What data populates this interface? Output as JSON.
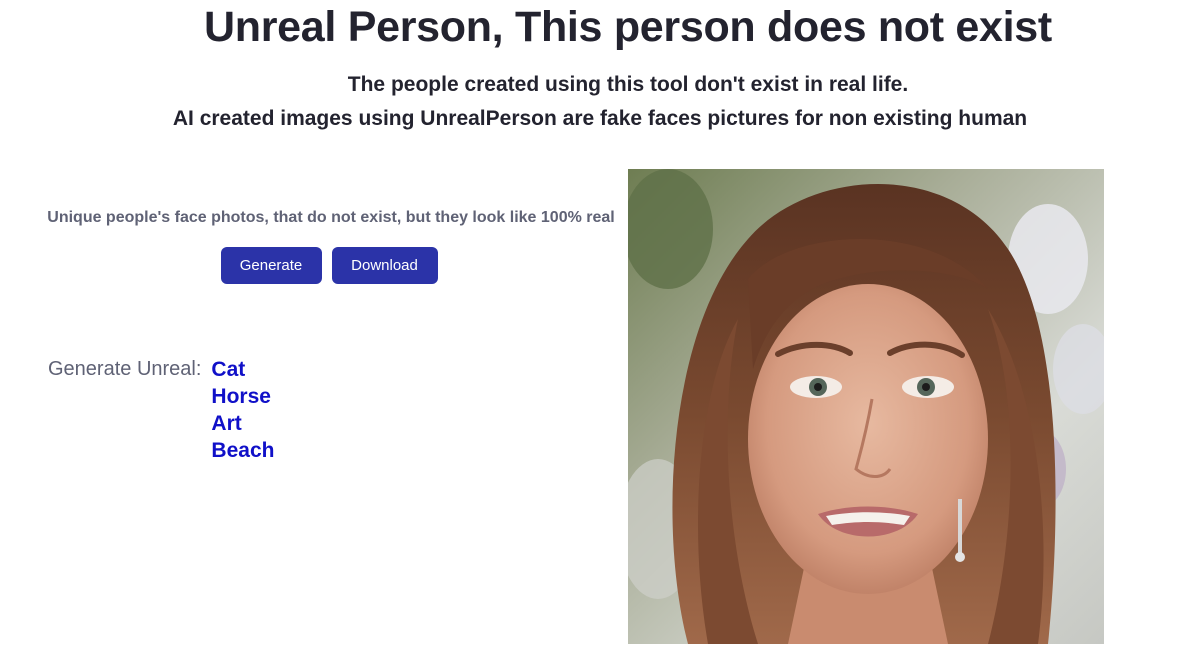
{
  "header": {
    "title": "Unreal Person, This person does not exist",
    "subtitle_line1": "The people created using this tool don't exist in real life.",
    "subtitle_line2": "AI created images using UnrealPerson are fake faces pictures for non existing human"
  },
  "main": {
    "tagline": "Unique people's face photos, that do not exist, but they look like 100% real",
    "buttons": {
      "generate_label": "Generate",
      "download_label": "Download"
    },
    "generate_unreal": {
      "label": "Generate Unreal:",
      "links": [
        "Cat",
        "Horse",
        "Art",
        "Beach"
      ]
    }
  },
  "colors": {
    "button_bg": "#2b33a8",
    "link": "#1010c8",
    "heading": "#23232f",
    "muted_text": "#5f6275"
  },
  "image": {
    "alt": "generated face",
    "icon": "portrait-photo"
  }
}
